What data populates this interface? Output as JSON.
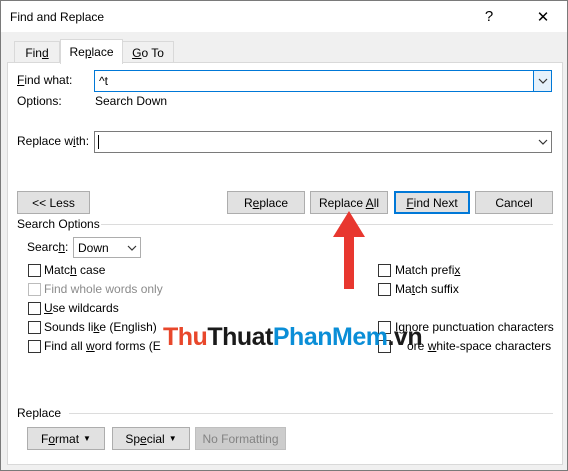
{
  "dialog": {
    "title": "Find and Replace",
    "help_glyph": "?",
    "close_glyph": "✕"
  },
  "tabs": [
    {
      "label": "Find",
      "accel": "d"
    },
    {
      "label": "Replace",
      "accel": "p"
    },
    {
      "label": "Go To",
      "accel": "G"
    }
  ],
  "find": {
    "label_pre": "",
    "label_accel": "F",
    "label_post": "ind what:",
    "value": "^t",
    "options_label": "Options:",
    "options_value": "Search Down"
  },
  "replace": {
    "label_pre": "Replace w",
    "label_accel": "i",
    "label_post": "th:",
    "value": ""
  },
  "buttons": {
    "less": "<< Less",
    "replace": "Replace",
    "replace_all": "Replace All",
    "find_next": "Find Next",
    "cancel": "Cancel"
  },
  "search_options": {
    "heading": "Search Options",
    "search_label": "Search:",
    "search_value": "Down",
    "left_checks": [
      {
        "label": "Match case",
        "checked": false,
        "disabled": false
      },
      {
        "label": "Find whole words only",
        "checked": false,
        "disabled": true
      },
      {
        "label": "Use wildcards",
        "checked": false,
        "disabled": false
      },
      {
        "label": "Sounds like (English)",
        "checked": false,
        "disabled": false
      },
      {
        "label": "Find all word forms (E",
        "checked": false,
        "disabled": false
      }
    ],
    "right_checks": [
      {
        "label": "Match prefix",
        "checked": false,
        "disabled": false
      },
      {
        "label": "Match suffix",
        "checked": false,
        "disabled": false
      },
      {
        "label": "Ignore punctuation characters",
        "checked": false,
        "disabled": false
      },
      {
        "label": "ore white-space characters",
        "checked": false,
        "disabled": false
      }
    ]
  },
  "replace_section": {
    "heading": "Replace",
    "format": "Format",
    "special": "Special",
    "no_formatting": "No Formatting"
  },
  "watermark": {
    "part1": "Thu",
    "part2": "Thuat",
    "part3": "PhanMem",
    "part4": ".vn"
  },
  "colors": {
    "accent": "#0078d7",
    "arrow": "#e8372f"
  }
}
